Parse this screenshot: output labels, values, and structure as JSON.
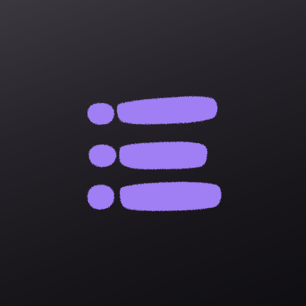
{
  "icon": {
    "glyph": "list-icon",
    "accent_color": "#a07ef4",
    "background_top": "#3b383f",
    "background_bottom": "#0f0e12"
  }
}
